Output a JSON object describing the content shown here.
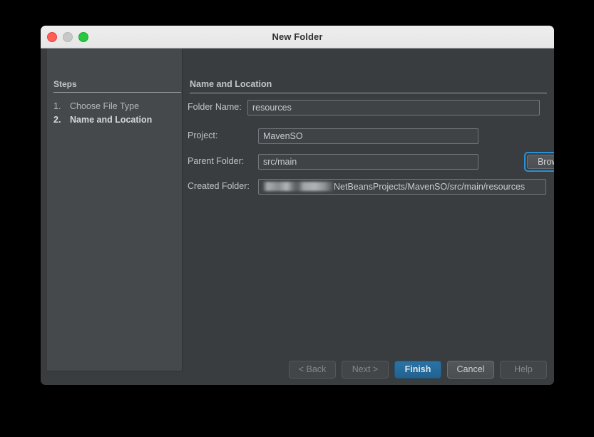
{
  "window": {
    "title": "New Folder",
    "traffic_lights": [
      {
        "name": "close",
        "color": "#ff5f57"
      },
      {
        "name": "minimize",
        "color": "#c8c8c8"
      },
      {
        "name": "maximize",
        "color": "#28c840"
      }
    ]
  },
  "steps": {
    "header": "Steps",
    "items": [
      {
        "number": "1.",
        "label": "Choose File Type",
        "active": false
      },
      {
        "number": "2.",
        "label": "Name and Location",
        "active": true
      }
    ]
  },
  "content": {
    "header": "Name and Location",
    "fields": [
      {
        "id": "foldername",
        "label": "Folder Name:",
        "value": "resources"
      },
      {
        "id": "project",
        "label": "Project:",
        "value": "MavenSO"
      },
      {
        "id": "parent",
        "label": "Parent Folder:",
        "value": "src/main"
      },
      {
        "id": "created",
        "label": "Created Folder:",
        "value": "NetBeansProjects/MavenSO/src/main/resources",
        "redacted_prefix": true
      }
    ],
    "browse_button": "Browse..."
  },
  "footer": {
    "buttons": [
      {
        "label": "< Back",
        "state": "disabled"
      },
      {
        "label": "Next >",
        "state": "disabled"
      },
      {
        "label": "Finish",
        "state": "default"
      },
      {
        "label": "Cancel",
        "state": "enabled"
      },
      {
        "label": "Help",
        "state": "disabled"
      }
    ]
  },
  "colors": {
    "accent": "#2a8fd4",
    "default_button": "#22628f",
    "window_body": "#3a3d40",
    "steps_panel": "#46494c",
    "titlebar": "#ececec"
  }
}
